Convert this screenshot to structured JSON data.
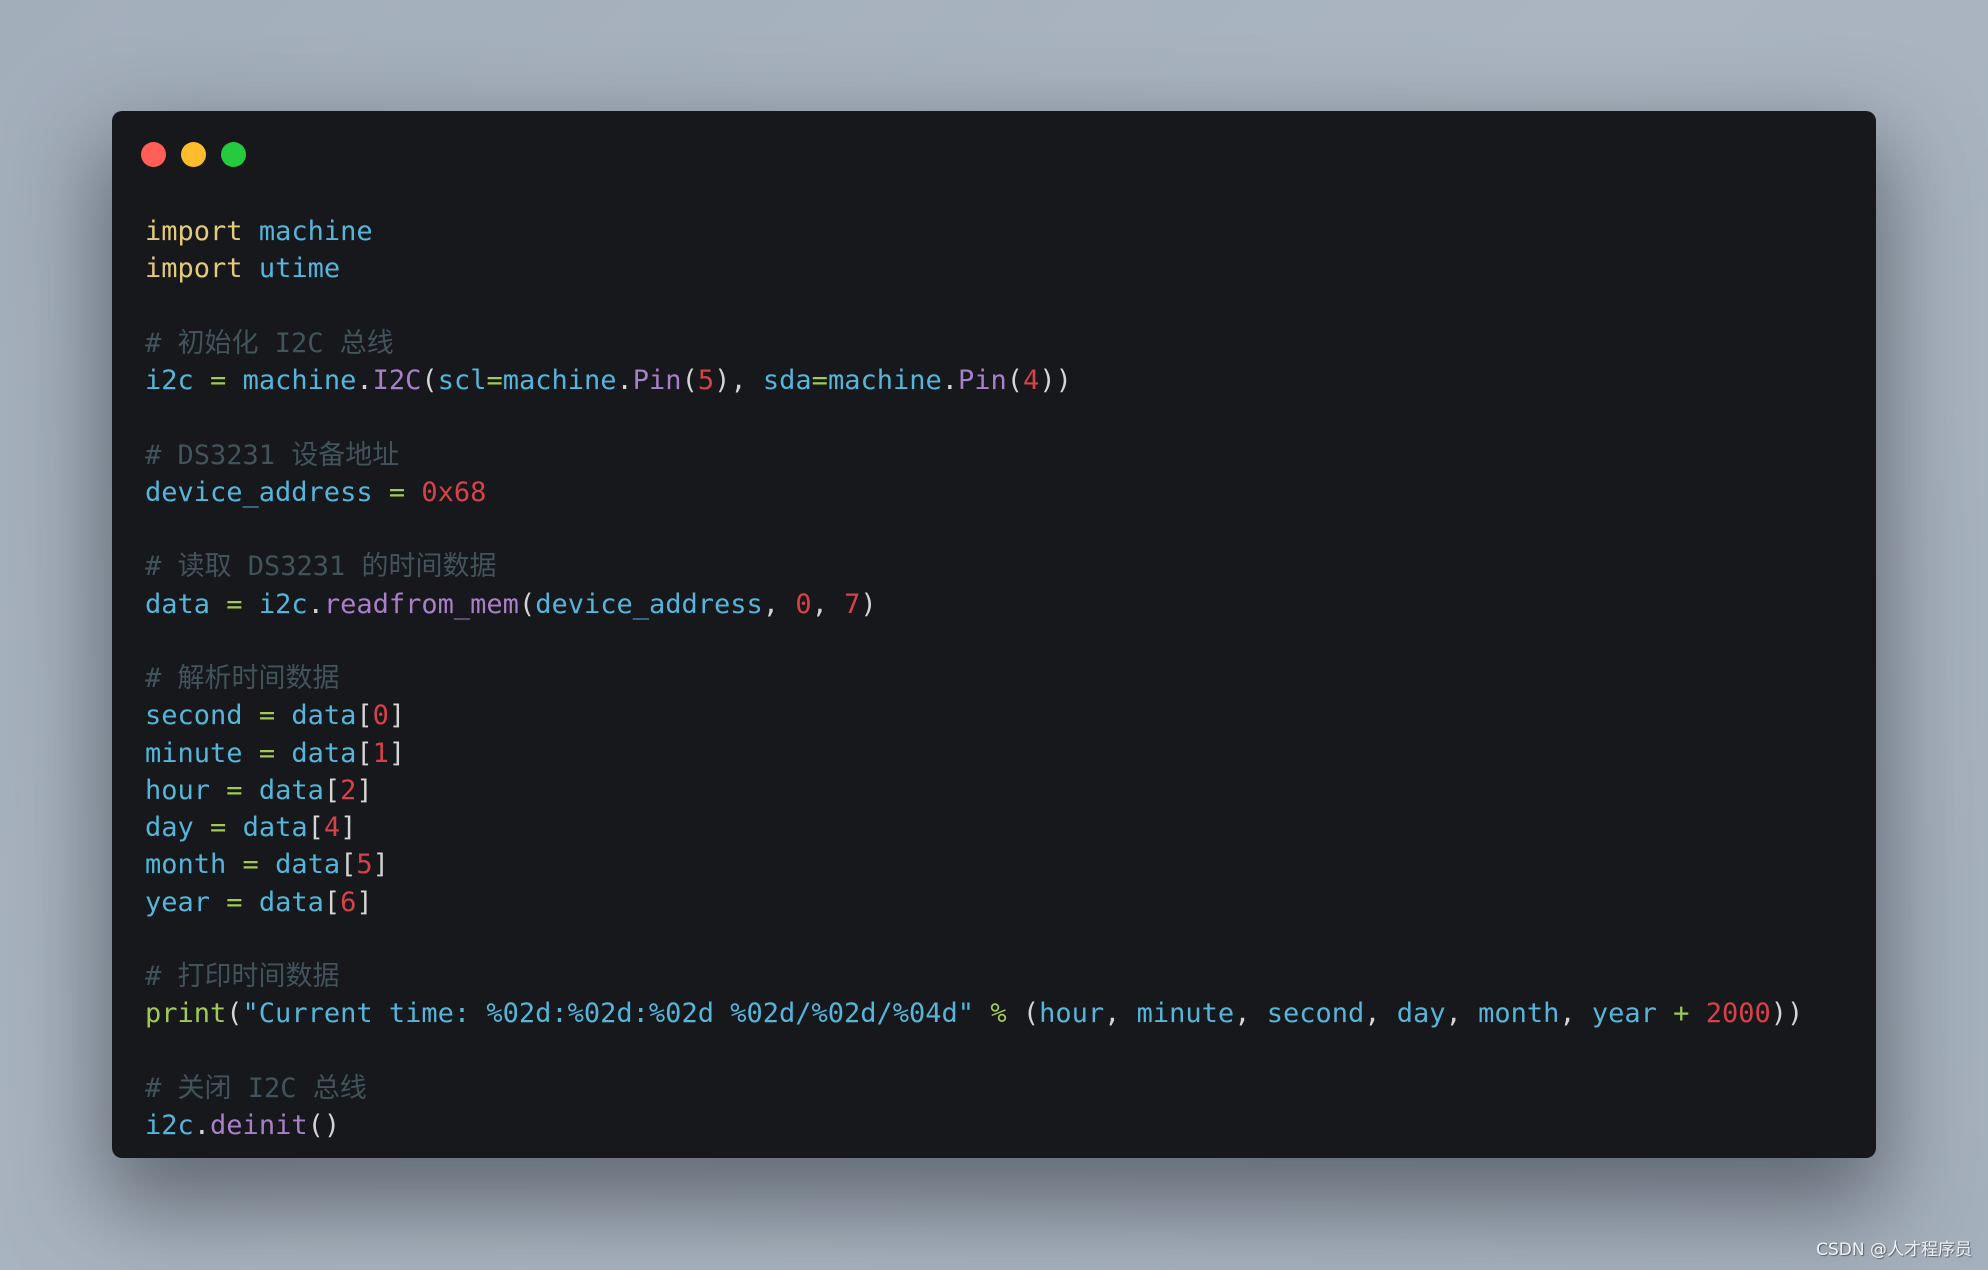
{
  "window": {
    "controls": [
      {
        "name": "close",
        "color": "#ff5f56"
      },
      {
        "name": "minimize",
        "color": "#ffbd2e"
      },
      {
        "name": "maximize",
        "color": "#27c93f"
      }
    ]
  },
  "code": {
    "language": "python",
    "lines": [
      [
        {
          "t": "import",
          "k": "keyword"
        },
        {
          "t": " ",
          "k": "plain"
        },
        {
          "t": "machine",
          "k": "ident"
        }
      ],
      [
        {
          "t": "import",
          "k": "keyword"
        },
        {
          "t": " ",
          "k": "plain"
        },
        {
          "t": "utime",
          "k": "ident"
        }
      ],
      [],
      [
        {
          "t": "# 初始化 I2C 总线",
          "k": "comment"
        }
      ],
      [
        {
          "t": "i2c",
          "k": "ident"
        },
        {
          "t": " ",
          "k": "plain"
        },
        {
          "t": "=",
          "k": "op"
        },
        {
          "t": " ",
          "k": "plain"
        },
        {
          "t": "machine",
          "k": "ident"
        },
        {
          "t": ".",
          "k": "punct"
        },
        {
          "t": "I2C",
          "k": "func"
        },
        {
          "t": "(",
          "k": "punct"
        },
        {
          "t": "scl",
          "k": "ident"
        },
        {
          "t": "=",
          "k": "op"
        },
        {
          "t": "machine",
          "k": "ident"
        },
        {
          "t": ".",
          "k": "punct"
        },
        {
          "t": "Pin",
          "k": "func"
        },
        {
          "t": "(",
          "k": "punct"
        },
        {
          "t": "5",
          "k": "num"
        },
        {
          "t": "), ",
          "k": "punct"
        },
        {
          "t": "sda",
          "k": "ident"
        },
        {
          "t": "=",
          "k": "op"
        },
        {
          "t": "machine",
          "k": "ident"
        },
        {
          "t": ".",
          "k": "punct"
        },
        {
          "t": "Pin",
          "k": "func"
        },
        {
          "t": "(",
          "k": "punct"
        },
        {
          "t": "4",
          "k": "num"
        },
        {
          "t": "))",
          "k": "punct"
        }
      ],
      [],
      [
        {
          "t": "# DS3231 设备地址",
          "k": "comment"
        }
      ],
      [
        {
          "t": "device_address",
          "k": "ident"
        },
        {
          "t": " ",
          "k": "plain"
        },
        {
          "t": "=",
          "k": "op"
        },
        {
          "t": " ",
          "k": "plain"
        },
        {
          "t": "0x68",
          "k": "num"
        }
      ],
      [],
      [
        {
          "t": "# 读取 DS3231 的时间数据",
          "k": "comment"
        }
      ],
      [
        {
          "t": "data",
          "k": "ident"
        },
        {
          "t": " ",
          "k": "plain"
        },
        {
          "t": "=",
          "k": "op"
        },
        {
          "t": " ",
          "k": "plain"
        },
        {
          "t": "i2c",
          "k": "ident"
        },
        {
          "t": ".",
          "k": "punct"
        },
        {
          "t": "readfrom_mem",
          "k": "func"
        },
        {
          "t": "(",
          "k": "punct"
        },
        {
          "t": "device_address",
          "k": "ident"
        },
        {
          "t": ", ",
          "k": "punct"
        },
        {
          "t": "0",
          "k": "num"
        },
        {
          "t": ", ",
          "k": "punct"
        },
        {
          "t": "7",
          "k": "num"
        },
        {
          "t": ")",
          "k": "punct"
        }
      ],
      [],
      [
        {
          "t": "# 解析时间数据",
          "k": "comment"
        }
      ],
      [
        {
          "t": "second",
          "k": "ident"
        },
        {
          "t": " ",
          "k": "plain"
        },
        {
          "t": "=",
          "k": "op"
        },
        {
          "t": " ",
          "k": "plain"
        },
        {
          "t": "data",
          "k": "ident"
        },
        {
          "t": "[",
          "k": "punct"
        },
        {
          "t": "0",
          "k": "num"
        },
        {
          "t": "]",
          "k": "punct"
        }
      ],
      [
        {
          "t": "minute",
          "k": "ident"
        },
        {
          "t": " ",
          "k": "plain"
        },
        {
          "t": "=",
          "k": "op"
        },
        {
          "t": " ",
          "k": "plain"
        },
        {
          "t": "data",
          "k": "ident"
        },
        {
          "t": "[",
          "k": "punct"
        },
        {
          "t": "1",
          "k": "num"
        },
        {
          "t": "]",
          "k": "punct"
        }
      ],
      [
        {
          "t": "hour",
          "k": "ident"
        },
        {
          "t": " ",
          "k": "plain"
        },
        {
          "t": "=",
          "k": "op"
        },
        {
          "t": " ",
          "k": "plain"
        },
        {
          "t": "data",
          "k": "ident"
        },
        {
          "t": "[",
          "k": "punct"
        },
        {
          "t": "2",
          "k": "num"
        },
        {
          "t": "]",
          "k": "punct"
        }
      ],
      [
        {
          "t": "day",
          "k": "ident"
        },
        {
          "t": " ",
          "k": "plain"
        },
        {
          "t": "=",
          "k": "op"
        },
        {
          "t": " ",
          "k": "plain"
        },
        {
          "t": "data",
          "k": "ident"
        },
        {
          "t": "[",
          "k": "punct"
        },
        {
          "t": "4",
          "k": "num"
        },
        {
          "t": "]",
          "k": "punct"
        }
      ],
      [
        {
          "t": "month",
          "k": "ident"
        },
        {
          "t": " ",
          "k": "plain"
        },
        {
          "t": "=",
          "k": "op"
        },
        {
          "t": " ",
          "k": "plain"
        },
        {
          "t": "data",
          "k": "ident"
        },
        {
          "t": "[",
          "k": "punct"
        },
        {
          "t": "5",
          "k": "num"
        },
        {
          "t": "]",
          "k": "punct"
        }
      ],
      [
        {
          "t": "year",
          "k": "ident"
        },
        {
          "t": " ",
          "k": "plain"
        },
        {
          "t": "=",
          "k": "op"
        },
        {
          "t": " ",
          "k": "plain"
        },
        {
          "t": "data",
          "k": "ident"
        },
        {
          "t": "[",
          "k": "punct"
        },
        {
          "t": "6",
          "k": "num"
        },
        {
          "t": "]",
          "k": "punct"
        }
      ],
      [],
      [
        {
          "t": "# 打印时间数据",
          "k": "comment"
        }
      ],
      [
        {
          "t": "print",
          "k": "op"
        },
        {
          "t": "(",
          "k": "punct"
        },
        {
          "t": "\"Current time: %02d:%02d:%02d %02d/%02d/%04d\"",
          "k": "str"
        },
        {
          "t": " ",
          "k": "plain"
        },
        {
          "t": "%",
          "k": "op"
        },
        {
          "t": " (",
          "k": "punct"
        },
        {
          "t": "hour",
          "k": "ident"
        },
        {
          "t": ", ",
          "k": "punct"
        },
        {
          "t": "minute",
          "k": "ident"
        },
        {
          "t": ", ",
          "k": "punct"
        },
        {
          "t": "second",
          "k": "ident"
        },
        {
          "t": ", ",
          "k": "punct"
        },
        {
          "t": "day",
          "k": "ident"
        },
        {
          "t": ", ",
          "k": "punct"
        },
        {
          "t": "month",
          "k": "ident"
        },
        {
          "t": ", ",
          "k": "punct"
        },
        {
          "t": "year",
          "k": "ident"
        },
        {
          "t": " ",
          "k": "plain"
        },
        {
          "t": "+",
          "k": "op"
        },
        {
          "t": " ",
          "k": "plain"
        },
        {
          "t": "2000",
          "k": "num"
        },
        {
          "t": "))",
          "k": "punct"
        }
      ],
      [],
      [
        {
          "t": "# 关闭 I2C 总线",
          "k": "comment"
        }
      ],
      [
        {
          "t": "i2c",
          "k": "ident"
        },
        {
          "t": ".",
          "k": "punct"
        },
        {
          "t": "deinit",
          "k": "func"
        },
        {
          "t": "()",
          "k": "punct"
        }
      ]
    ]
  },
  "colors": {
    "window_bg": "#17181b",
    "keyword": "#e5c97a",
    "identifier": "#55b5db",
    "function": "#a87fc8",
    "operator": "#9fca56",
    "number": "#d7414a",
    "comment": "#41535b"
  },
  "watermark": "CSDN @人才程序员"
}
